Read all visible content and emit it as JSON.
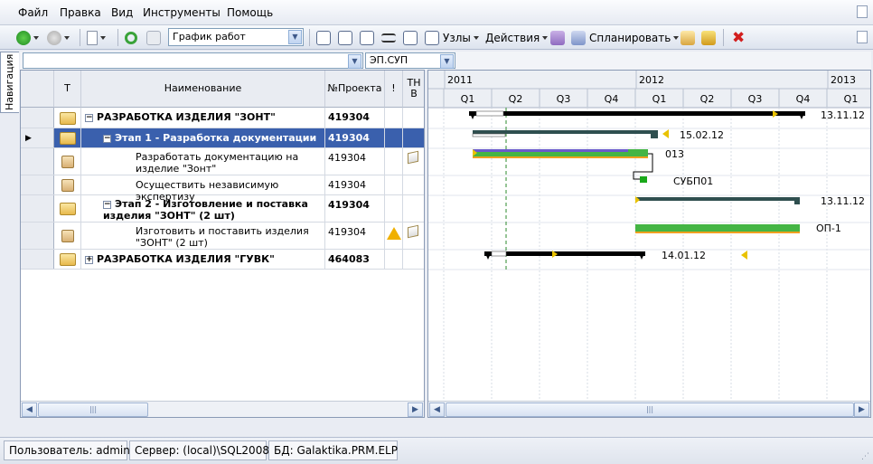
{
  "menu": {
    "items": [
      "Файл",
      "Правка",
      "Вид",
      "Инструменты",
      "Помощь"
    ]
  },
  "toolbar": {
    "view_value": "График работ",
    "nodes_label": "Узлы",
    "actions_label": "Действия",
    "plan_label": "Спланировать"
  },
  "sidebar": {
    "tab_label": "Навигация"
  },
  "filter": {
    "right_value": "ЭП.СУП"
  },
  "grid": {
    "headers": {
      "type": "Т",
      "name": "Наименование",
      "project": "№Проекта",
      "warn": "!",
      "tnv": "ТН В"
    },
    "rows": [
      {
        "name": "РАЗРАБОТКА ИЗДЕЛИЯ \"ЗОНТ\"",
        "project": "419304",
        "bold": true,
        "level": 0,
        "expander": "−"
      },
      {
        "name": "Этап 1 - Разработка документации",
        "project": "419304",
        "bold": true,
        "level": 1,
        "expander": "−",
        "selected": true
      },
      {
        "name": "Разработать документацию на изделие \"Зонт\"",
        "project": "419304",
        "bold": false,
        "level": 2
      },
      {
        "name": "Осуществить независимую экспертизу",
        "project": "419304",
        "bold": false,
        "level": 2
      },
      {
        "name": "Этап 2 - Изготовление и поставка изделия \"ЗОНТ\" (2 шт)",
        "project": "419304",
        "bold": true,
        "level": 1,
        "expander": "−"
      },
      {
        "name": "Изготовить и поставить  изделия \"ЗОНТ\" (2 шт)",
        "project": "419304",
        "bold": false,
        "level": 2
      },
      {
        "name": "РАЗРАБОТКА ИЗДЕЛИЯ \"ГУВК\"",
        "project": "464083",
        "bold": true,
        "level": 0,
        "expander": "+"
      }
    ]
  },
  "gantt": {
    "years": [
      "2011",
      "2012",
      "2013"
    ],
    "quarters": [
      "Q1",
      "Q2",
      "Q3",
      "Q4",
      "Q1",
      "Q2",
      "Q3",
      "Q4",
      "Q1"
    ],
    "labels": [
      "13.11.12",
      "15.02.12",
      "013",
      "СУБП01",
      "13.11.12",
      "ОП-1",
      "14.01.12"
    ]
  },
  "status": {
    "user": "Пользователь: admin",
    "server": "Сервер: (local)\\SQL2008",
    "db": "БД: Galaktika.PRM.ELP"
  },
  "colors": {
    "selection": "#3a60ad",
    "task_green": "#44b544",
    "summary_black": "#000000",
    "chrome": "#e9ecf3"
  }
}
